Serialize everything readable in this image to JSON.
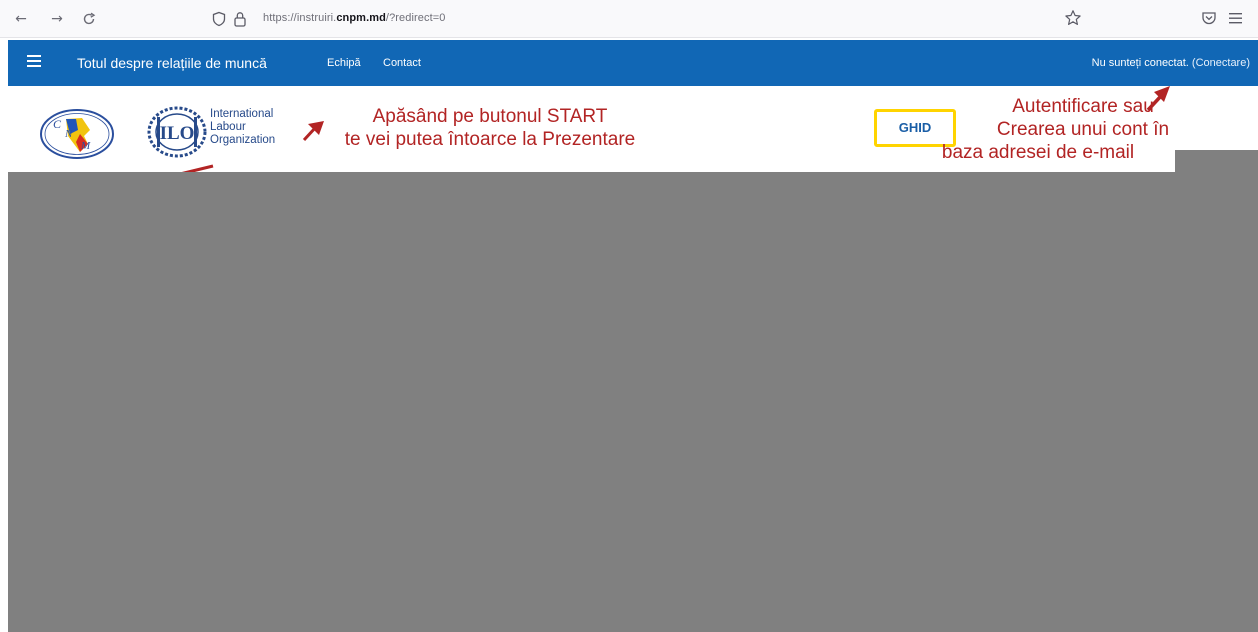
{
  "browser": {
    "url_prefix": "https://instruiri.",
    "url_domain": "cnpm.md",
    "url_suffix": "/?redirect=0",
    "back_glyph": "←",
    "forward_glyph": "→",
    "reload_glyph": "C"
  },
  "navbar": {
    "brand": "Totul despre relațiile de muncă",
    "links": [
      "Echipă",
      "Contact"
    ],
    "login_status": "Nu sunteți conectat.",
    "login_link": "(Conectare)",
    "color": "#1167b5"
  },
  "header": {
    "ilo_lines": [
      "International",
      "Labour",
      "Organization"
    ],
    "ghid_label": "GHID",
    "annotation_start": [
      "Apăsând pe butonul START",
      "te vei putea întoarce la Prezentare"
    ],
    "annotation_auth": [
      "Autentificare sau",
      "Crearea unui cont în",
      "baza adresei de e-mail"
    ],
    "annotation_color": "#b22424"
  },
  "icons": {
    "back": "arrow-left-icon",
    "forward": "arrow-right-icon",
    "reload": "reload-icon",
    "tracking": "shield-icon",
    "lock": "lock-icon",
    "bookmark": "star-icon",
    "pocket": "pocket-icon",
    "app_menu": "menu-icon",
    "site_menu": "hamburger-icon"
  }
}
